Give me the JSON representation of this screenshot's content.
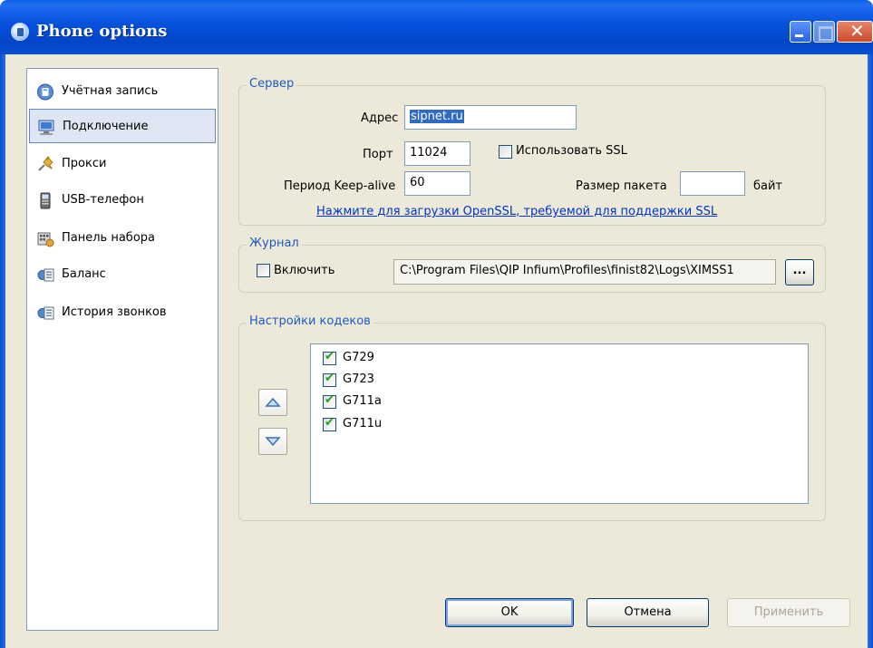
{
  "window": {
    "title": "Phone options"
  },
  "nav": {
    "items": [
      {
        "label": "Учётная запись"
      },
      {
        "label": "Подключение"
      },
      {
        "label": "Прокси"
      },
      {
        "label": "USB-телефон"
      },
      {
        "label": "Панель набора"
      },
      {
        "label": "Баланс"
      },
      {
        "label": "История звонков"
      }
    ],
    "selected": "Подключение"
  },
  "server": {
    "legend": "Сервер",
    "address_label": "Адрес",
    "address_value": "sipnet.ru",
    "port_label": "Порт",
    "port_value": "11024",
    "ssl_label": "Использовать SSL",
    "ssl_checked": false,
    "keepalive_label": "Период Keep-alive",
    "keepalive_value": "60",
    "packet_label": "Размер пакета",
    "packet_value": "",
    "packet_unit": "байт",
    "openssl_link": "Нажмите для загрузки OpenSSL, требуемой для поддержки SSL"
  },
  "journal": {
    "legend": "Журнал",
    "enable_label": "Включить",
    "enable_checked": false,
    "path": "C:\\Program Files\\QIP Infium\\Profiles\\finist82\\Logs\\XIMSS1",
    "browse_label": "..."
  },
  "codecs": {
    "legend": "Настройки кодеков",
    "items": [
      {
        "name": "G729",
        "checked": true
      },
      {
        "name": "G723",
        "checked": true
      },
      {
        "name": "G711a",
        "checked": true
      },
      {
        "name": "G711u",
        "checked": true
      }
    ]
  },
  "buttons": {
    "ok": "OK",
    "cancel": "Отмена",
    "apply": "Применить"
  }
}
